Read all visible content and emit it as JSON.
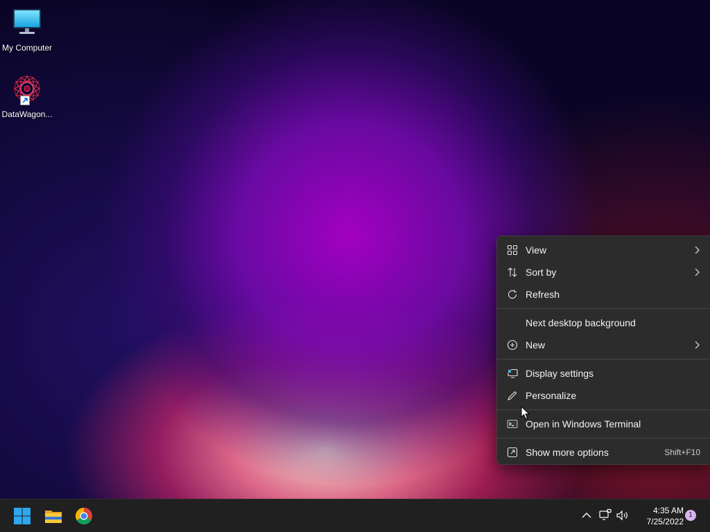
{
  "desktop": {
    "icons": [
      {
        "label": "My Computer",
        "icon": "monitor-icon"
      },
      {
        "label": "DataWagon...",
        "icon": "datawagon-app-icon",
        "shortcut": true
      }
    ]
  },
  "context_menu": {
    "items": [
      {
        "label": "View",
        "icon": "grid-view-icon",
        "submenu": true
      },
      {
        "label": "Sort by",
        "icon": "sort-arrows-icon",
        "submenu": true
      },
      {
        "label": "Refresh",
        "icon": "refresh-icon"
      },
      {
        "label": "Next desktop background"
      },
      {
        "label": "New",
        "icon": "plus-circle-icon",
        "submenu": true
      },
      {
        "label": "Display settings",
        "icon": "display-settings-icon"
      },
      {
        "label": "Personalize",
        "icon": "pen-icon"
      },
      {
        "label": "Open in Windows Terminal",
        "icon": "terminal-icon"
      },
      {
        "label": "Show more options",
        "icon": "share-options-icon",
        "shortcut": "Shift+F10"
      }
    ]
  },
  "taskbar": {
    "apps": [
      {
        "name": "start-button",
        "icon": "windows-logo-icon"
      },
      {
        "name": "file-explorer-button",
        "icon": "folder-icon"
      },
      {
        "name": "chrome-button",
        "icon": "chrome-icon"
      }
    ],
    "tray": {
      "time": "4:35 AM",
      "date": "7/25/2022",
      "notification_count": "1"
    }
  },
  "colors": {
    "menu_bg": "#2c2c2c",
    "taskbar_bg": "#202020",
    "accent_blue": "#4cc2ff"
  }
}
